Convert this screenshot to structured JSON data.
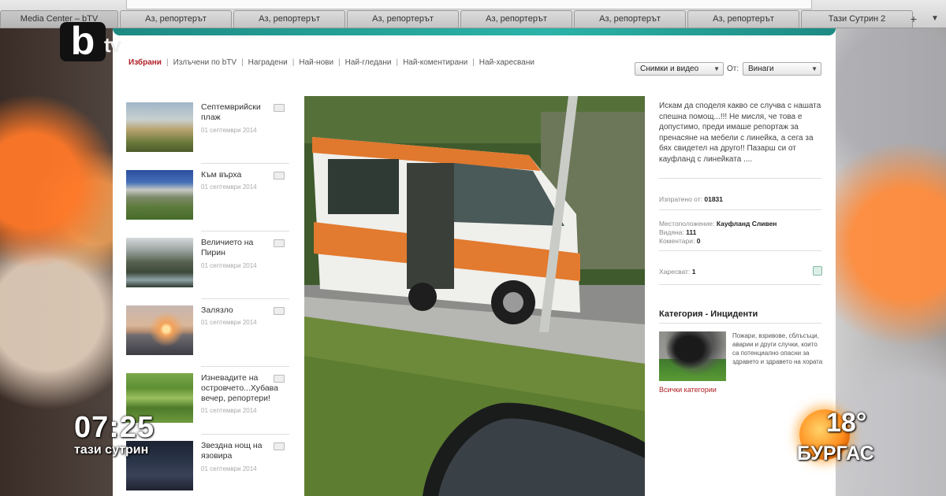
{
  "browser": {
    "url": "",
    "tabs": [
      "Media Center – bTV",
      "Аз, репортерът",
      "Аз, репортерът",
      "Аз, репортерът",
      "Аз, репортерът",
      "Аз, репортерът",
      "Аз, репортерът",
      "Тази Сутрин 2"
    ],
    "new_tab": "+",
    "menu": "▼"
  },
  "nav": {
    "items": [
      "Избрани",
      "Излъчени по bTV",
      "Наградени",
      "Най-нови",
      "Най-гледани",
      "Най-коментирани",
      "Най-харесвани"
    ],
    "separator": "|"
  },
  "filter": {
    "type_value": "Снимки и видео",
    "from_label": "От:",
    "period_value": "Винаги"
  },
  "list": [
    {
      "title": "Септемврийски плаж",
      "date": "01 септември 2014"
    },
    {
      "title": "Към върха",
      "date": "01 септември 2014"
    },
    {
      "title": "Величието на Пирин",
      "date": "01 септември 2014"
    },
    {
      "title": "Залязло",
      "date": "01 септември 2014"
    },
    {
      "title": "Изневадите на островчето...Хубава вечер, репортери!",
      "date": "01 септември 2014"
    },
    {
      "title": "Звездна нощ на язовира",
      "date": "01 септември 2014"
    }
  ],
  "post": {
    "description": "Искам да споделя какво се случва с нашата спешна помощ...!!! Не мисля, че това е допустимо, преди имаше репортаж за пренасяне на мебели с линейка, а сега за бях свидетел на друго!! Пазарш си от кауфланд с линейката ....",
    "sent_by_label": "Изпратено от:",
    "sent_by_value": "01831",
    "location_label": "Местоположение:",
    "location_value": "Кауфланд Сливен",
    "views_label": "Видяна:",
    "views_value": "111",
    "comments_label": "Коментари:",
    "comments_value": "0",
    "likes_label": "Харесват:",
    "likes_value": "1"
  },
  "category": {
    "title": "Категория - Инциденти",
    "description": "Пожари, взривове, сблъсъци, аварии и други случки, които са потенциално опасни за здравето и здравето на хората",
    "all_link": "Всички категории"
  },
  "tv": {
    "logo_b": "b",
    "logo_tv": "tv",
    "time": "07:25",
    "show": "тази сутрин",
    "temperature": "18°",
    "city": "БУРГАС"
  }
}
